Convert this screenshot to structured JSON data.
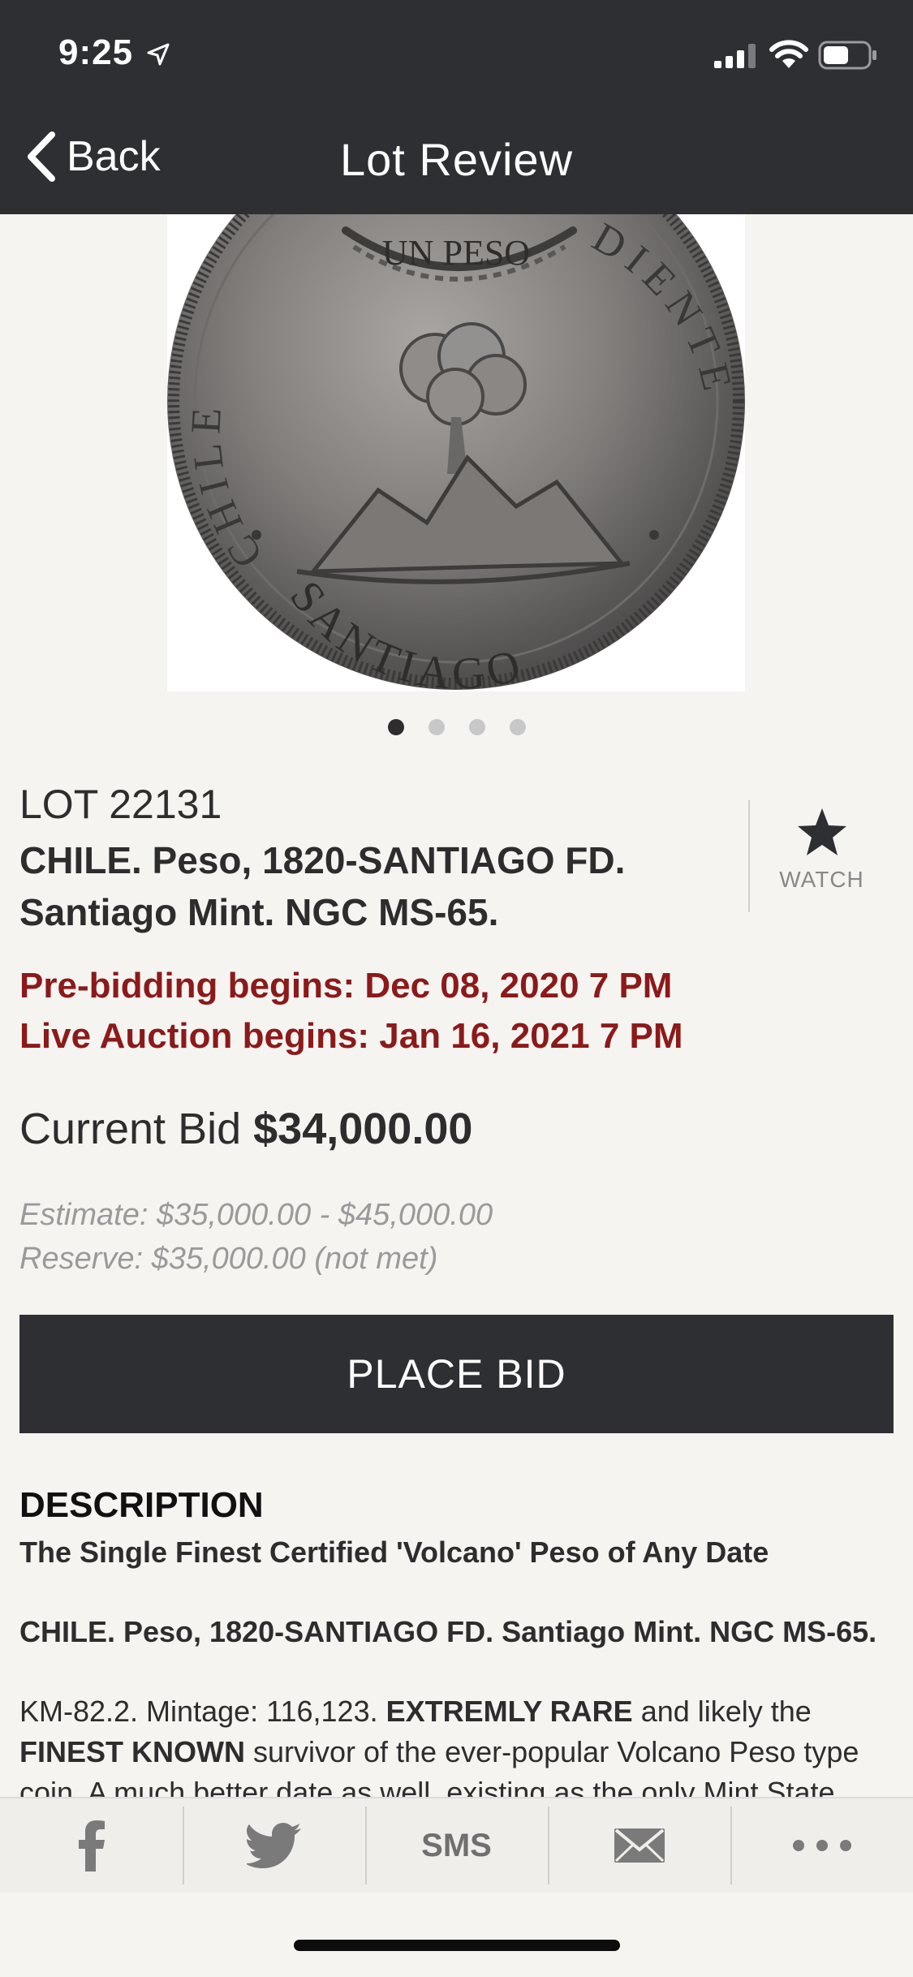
{
  "status_bar": {
    "time": "9:25",
    "icons": [
      "location-arrow-icon",
      "signal-icon",
      "wifi-icon",
      "battery-icon"
    ]
  },
  "nav": {
    "back_label": "Back",
    "title": "Lot Review"
  },
  "image": {
    "coin_texts": [
      "UN PESO",
      "CHILE",
      "DIENTE",
      "SANTIAGO"
    ],
    "page_count": 4,
    "active_page": 1
  },
  "lot": {
    "number": "LOT 22131",
    "title_line1": "CHILE. Peso, 1820-SANTIAGO FD.",
    "title_line2": "Santiago Mint. NGC MS-65.",
    "watch_label": "WATCH"
  },
  "schedule": {
    "prebidding": "Pre-bidding begins: Dec 08, 2020 7 PM",
    "live": "Live Auction begins: Jan 16, 2021 7 PM"
  },
  "bid": {
    "label": "Current Bid",
    "amount": "$34,000.00",
    "estimate": "Estimate: $35,000.00 - $45,000.00",
    "reserve": "Reserve: $35,000.00 (not met)",
    "place_bid_label": "PLACE BID"
  },
  "description": {
    "heading": "DESCRIPTION",
    "subtitle": "The Single Finest Certified 'Volcano' Peso of Any Date",
    "line2": "CHILE. Peso, 1820-SANTIAGO FD. Santiago Mint. NGC MS-65.",
    "body_1": "KM-82.2. Mintage: 116,123. ",
    "body_2": "EXTREMLY RARE",
    "body_3": " and likely the ",
    "body_4": "FINEST KNOWN",
    "body_5": " survivor of the ever-popular Volcano Peso type coin. A much better date as well, existing as the only Mint State"
  },
  "share": {
    "sms_label": "SMS",
    "items": [
      "facebook-icon",
      "twitter-icon",
      "sms",
      "mail-icon",
      "more-icon"
    ]
  },
  "colors": {
    "dark_bar": "#2d2f33",
    "accent_red": "#8b1a1a",
    "background": "#f5f4f1",
    "muted": "#9a9a9a"
  }
}
